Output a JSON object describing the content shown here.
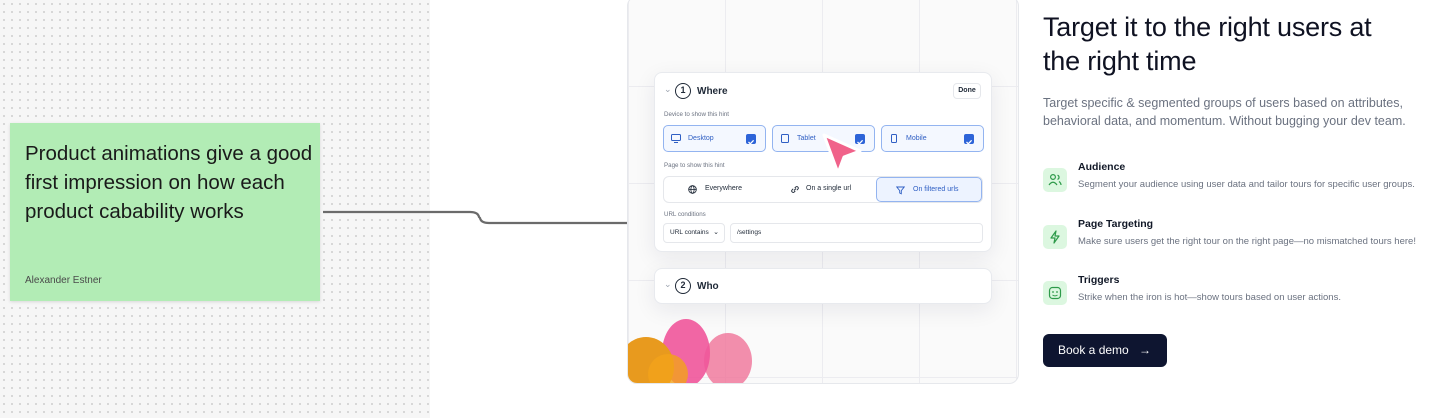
{
  "sticky_note": {
    "text": "Product animations give a good first impression on how each product cabability works",
    "author": "Alexander Estner"
  },
  "card": {
    "where_step": {
      "number": "1",
      "title": "Where",
      "done_label": "Done"
    },
    "device_label": "Device to show this hint",
    "devices": [
      {
        "label": "Desktop",
        "checked": true,
        "icon": "monitor-icon"
      },
      {
        "label": "Tablet",
        "checked": true,
        "icon": "tablet-icon"
      },
      {
        "label": "Mobile",
        "checked": true,
        "icon": "mobile-icon"
      }
    ],
    "page_label": "Page to show this hint",
    "page_options": [
      {
        "label": "Everywhere",
        "icon": "globe-icon",
        "selected": false
      },
      {
        "label": "On a single url",
        "icon": "link-icon",
        "selected": false
      },
      {
        "label": "On filtered urls",
        "icon": "filter-icon",
        "selected": true
      }
    ],
    "url_conditions_label": "URL conditions",
    "url_condition_select": "URL contains",
    "url_condition_value": "/settings",
    "who_step": {
      "number": "2",
      "title": "Who"
    }
  },
  "content": {
    "headline": "Target it to the right users at the right time",
    "subtext": "Target specific & segmented groups of users based on attributes, behavioral data, and momentum. Without bugging your dev team.",
    "features": [
      {
        "title": "Audience",
        "description": "Segment your audience using user data and tailor tours for specific user groups.",
        "icon": "users-icon"
      },
      {
        "title": "Page Targeting",
        "description": "Make sure users get the right tour on the right page—no mismatched tours here!",
        "icon": "lightning-icon"
      },
      {
        "title": "Triggers",
        "description": "Strike when the iron is hot—show tours based on user actions.",
        "icon": "trigger-icon"
      }
    ],
    "cta_label": "Book a demo",
    "cta_arrow": "→"
  },
  "colors": {
    "sticky": "#b2ecb5",
    "accent_blue": "#2d64d8",
    "cursor_pink": "#f0628a",
    "cta_bg": "#0e1530",
    "feature_icon_bg": "#dcf7e0"
  }
}
